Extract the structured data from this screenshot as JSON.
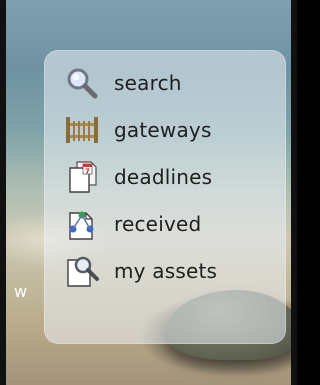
{
  "menu": {
    "items": [
      {
        "label": "search",
        "icon": "magnifier-icon"
      },
      {
        "label": "gateways",
        "icon": "gate-icon"
      },
      {
        "label": "deadlines",
        "icon": "calendar-documents-icon"
      },
      {
        "label": "received",
        "icon": "received-document-icon"
      },
      {
        "label": "my assets",
        "icon": "assets-document-search-icon"
      }
    ]
  },
  "background_side_text": "w",
  "colors": {
    "panel": "#ebf0f5",
    "label_text": "#202020",
    "frame": "#111111"
  }
}
